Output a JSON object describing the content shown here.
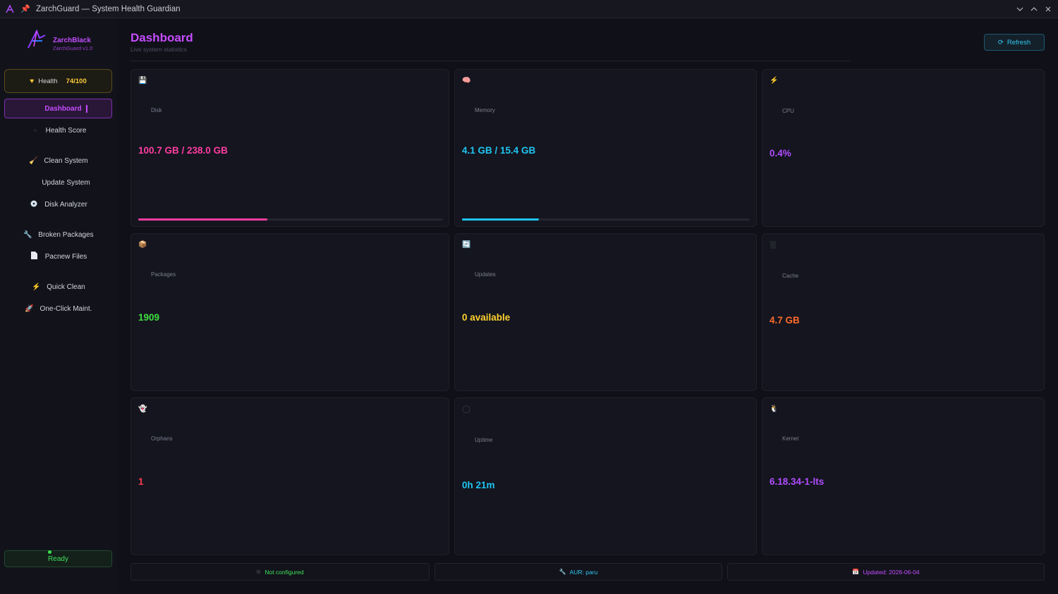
{
  "window": {
    "title": "ZarchGuard — System Health Guardian"
  },
  "brand": {
    "name": "ZarchBlack",
    "version": "ZarchGuard v1.0"
  },
  "health": {
    "label": "Health",
    "value": "74/100"
  },
  "nav": [
    {
      "label": "Dashboard",
      "icon": "home-icon",
      "active": true
    },
    {
      "label": "Health Score",
      "icon": "pulse-icon"
    },
    {
      "label": "Clean System",
      "icon": "broom-icon"
    },
    {
      "label": "Update System",
      "icon": "refresh-icon"
    },
    {
      "label": "Disk Analyzer",
      "icon": "disc-icon"
    },
    {
      "label": "Broken Packages",
      "icon": "wrench-icon"
    },
    {
      "label": "Pacnew Files",
      "icon": "file-icon"
    },
    {
      "label": "Quick Clean",
      "icon": "lightning-icon"
    },
    {
      "label": "One-Click Maint.",
      "icon": "rocket-icon"
    }
  ],
  "status": {
    "label": "Ready",
    "color": "#41e05a"
  },
  "header": {
    "title": "Dashboard",
    "subtitle": "Live system statistics",
    "refresh_label": "Refresh"
  },
  "cards": {
    "disk": {
      "label": "Disk",
      "value": "100.7 GB / 238.0 GB",
      "color": "#ff3da0",
      "progress": 0.423,
      "icon": "floppy-disk-icon"
    },
    "memory": {
      "label": "Memory",
      "value": "4.1 GB / 15.4 GB",
      "color": "#1fc4f0",
      "progress": 0.266,
      "icon": "brain-icon"
    },
    "cpu": {
      "label": "CPU",
      "value": "0.4%",
      "color": "#b24cff",
      "icon": "lightning-icon"
    },
    "packages": {
      "label": "Packages",
      "value": "1909",
      "color": "#3fe03f",
      "icon": "package-icon"
    },
    "updates": {
      "label": "Updates",
      "value": "0 available",
      "color": "#ffd12e",
      "icon": "refresh-icon"
    },
    "cache": {
      "label": "Cache",
      "value": "4.7 GB",
      "color": "#ff6a2a",
      "icon": "trash-icon"
    },
    "orphans": {
      "label": "Orphans",
      "value": "1",
      "color": "#ff3b4e",
      "icon": "ghost-icon"
    },
    "uptime": {
      "label": "Uptime",
      "value": "0h 21m",
      "color": "#1fc4f0",
      "icon": "clock-icon"
    },
    "kernel": {
      "label": "Kernel",
      "value": "6.18.34-1-lts",
      "color": "#b24cff",
      "icon": "penguin-icon"
    }
  },
  "footer": {
    "config": {
      "label": "Not configured",
      "color": "#41e05a"
    },
    "aur": {
      "label": "AUR: paru",
      "color": "#33c7f0"
    },
    "updated": {
      "label": "Updated: 2026-06-04",
      "color": "#c64dff"
    }
  }
}
